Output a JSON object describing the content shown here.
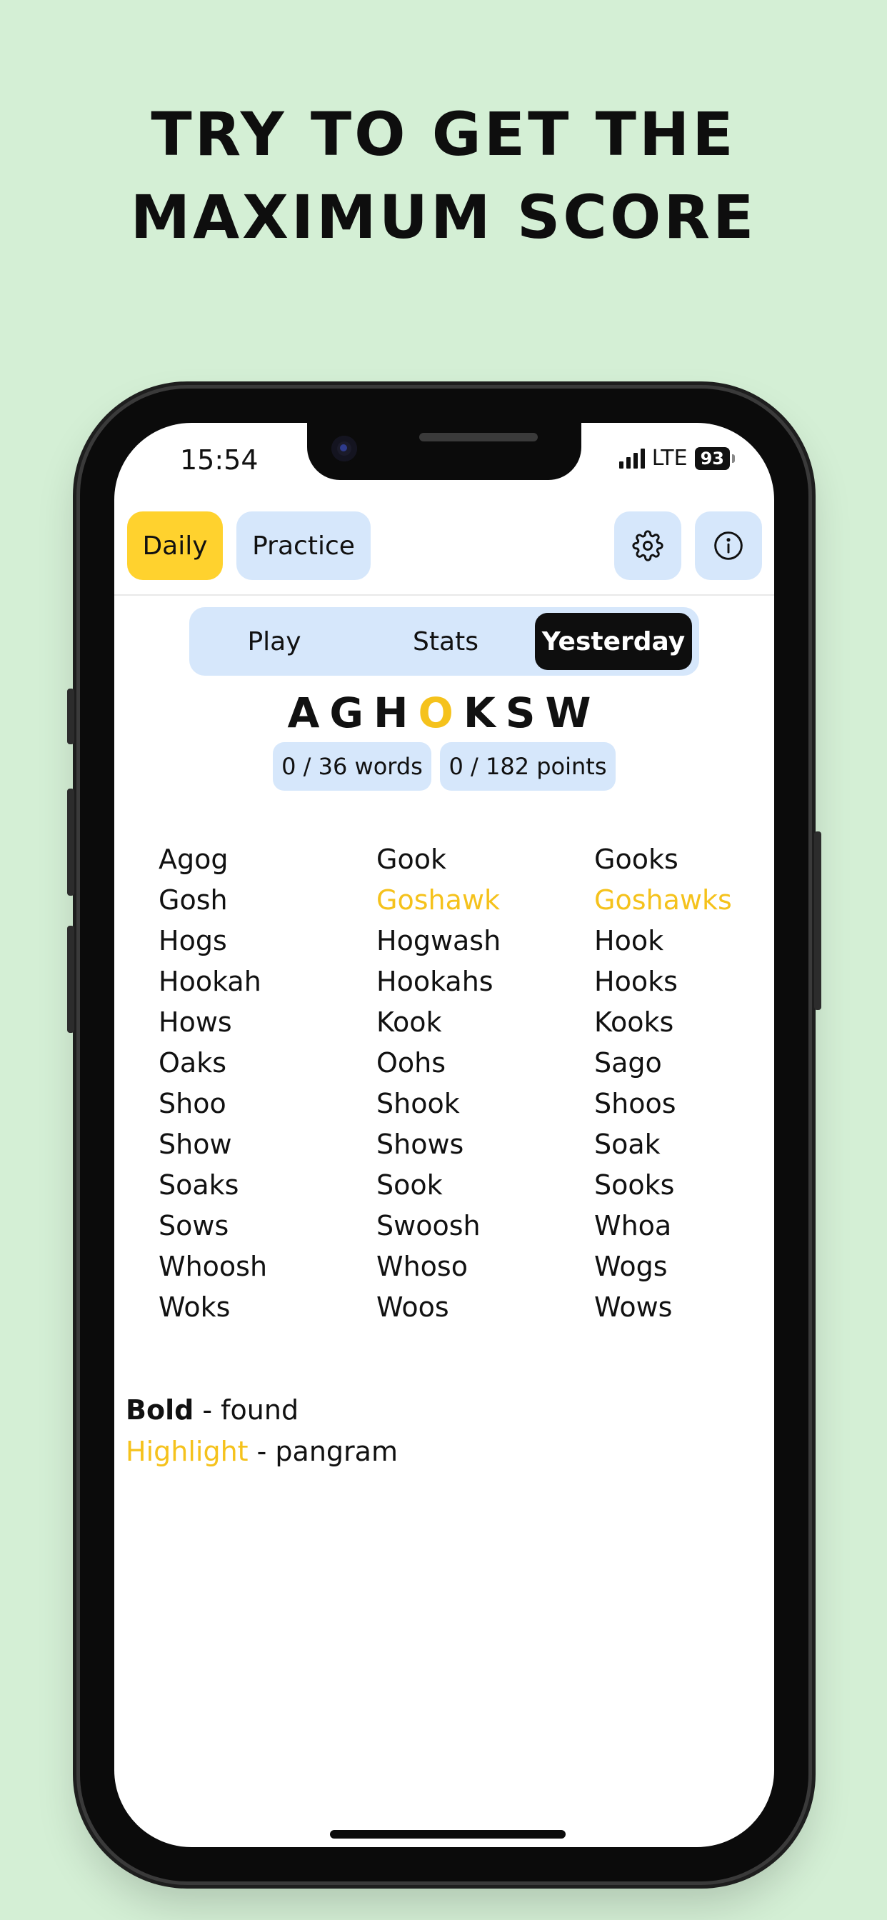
{
  "headline": {
    "line1": "TRY TO GET THE",
    "line2": "MAXIMUM SCORE"
  },
  "status_bar": {
    "time": "15:54",
    "network": "LTE",
    "battery": "93"
  },
  "mode_tabs": {
    "daily": "Daily",
    "practice": "Practice"
  },
  "icons": {
    "settings": "gear-icon",
    "info": "info-icon"
  },
  "view_tabs": {
    "play": "Play",
    "stats": "Stats",
    "yesterday": "Yesterday",
    "selected": "Yesterday"
  },
  "puzzle": {
    "letters_before": "AGH",
    "center_letter": "O",
    "letters_after": "KSW",
    "words_progress": "0 / 36 words",
    "points_progress": "0 / 182 points"
  },
  "words": [
    "Agog",
    "Gook",
    "Gooks",
    "Gosh",
    "Goshawk",
    "Goshawks",
    "Hogs",
    "Hogwash",
    "Hook",
    "Hookah",
    "Hookahs",
    "Hooks",
    "Hows",
    "Kook",
    "Kooks",
    "Oaks",
    "Oohs",
    "Sago",
    "Shoo",
    "Shook",
    "Shoos",
    "Show",
    "Shows",
    "Soak",
    "Soaks",
    "Sook",
    "Sooks",
    "Sows",
    "Swoosh",
    "Whoa",
    "Whoosh",
    "Whoso",
    "Wogs",
    "Woks",
    "Woos",
    "Wows"
  ],
  "pangrams": [
    "Goshawk",
    "Goshawks"
  ],
  "legend": {
    "bold_term": "Bold",
    "bold_desc": " - found",
    "highlight_term": "Highlight",
    "highlight_desc": " - pangram"
  },
  "colors": {
    "background": "#d4efd5",
    "accent_yellow": "#ffd22e",
    "pangram_yellow": "#f5c21c",
    "pill_blue": "#d6e7fb",
    "dark": "#0e0e0e"
  }
}
